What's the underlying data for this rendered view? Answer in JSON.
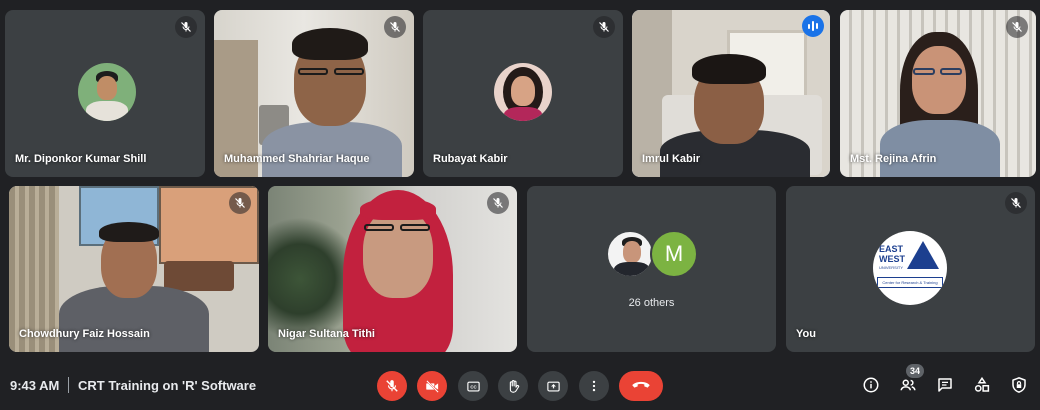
{
  "meeting": {
    "time": "9:43 AM",
    "title": "CRT Training on 'R' Software",
    "participant_count": "34"
  },
  "participants": [
    {
      "name": "Mr. Diponkor Kumar Shill",
      "muted": true,
      "camera": false
    },
    {
      "name": "Muhammed Shahriar Haque",
      "muted": true,
      "camera": true
    },
    {
      "name": "Rubayat Kabir",
      "muted": true,
      "camera": false
    },
    {
      "name": "Imrul Kabir",
      "muted": false,
      "camera": true,
      "speaking": true
    },
    {
      "name": "Mst. Rejina Afrin",
      "muted": true,
      "camera": true
    },
    {
      "name": "Chowdhury Faiz Hossain",
      "muted": true,
      "camera": true
    },
    {
      "name": "Nigar Sultana Tithi",
      "muted": true,
      "camera": true
    },
    {
      "name": "26 others",
      "initial": "M"
    },
    {
      "name": "You",
      "muted": true,
      "camera": false
    }
  ],
  "logo": {
    "line1": "EAST",
    "line2": "WEST",
    "line3": "UNIVERSITY",
    "caption": "Center for Research & Training"
  },
  "icons": [
    "mic-off-icon",
    "camera-off-icon",
    "captions-icon",
    "raise-hand-icon",
    "present-icon",
    "more-options-icon",
    "end-call-icon",
    "info-icon",
    "people-icon",
    "chat-icon",
    "activities-icon",
    "host-controls-icon"
  ],
  "colors": {
    "background": "#202124",
    "tile": "#3c4043",
    "danger": "#ea4335",
    "speaking": "#8ab4f8",
    "accent": "#1a73e8"
  }
}
